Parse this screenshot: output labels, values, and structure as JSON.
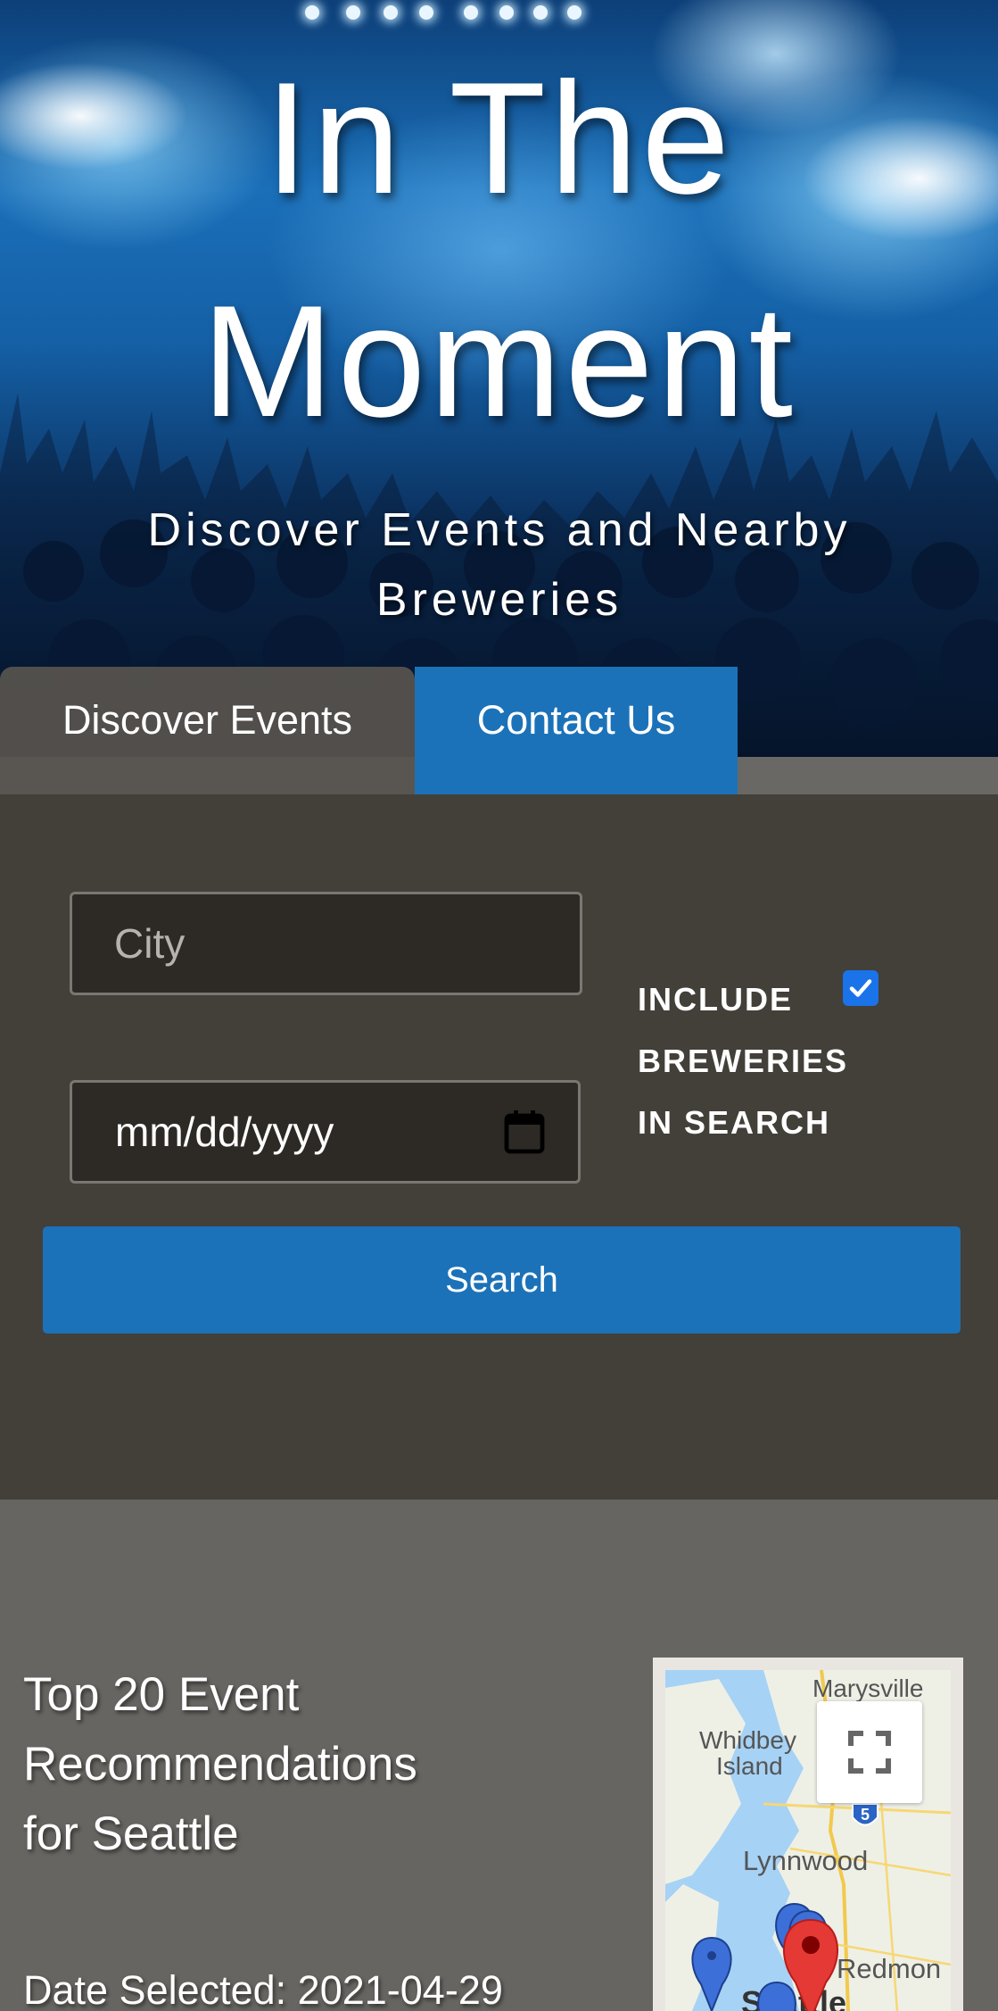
{
  "hero": {
    "title_line1": "In The",
    "title_line2": "Moment",
    "subtitle_line1": "Discover Events and Nearby",
    "subtitle_line2": "Breweries"
  },
  "tabs": [
    {
      "label": "Discover Events",
      "active": false
    },
    {
      "label": "Contact Us",
      "active": true
    }
  ],
  "search": {
    "city_placeholder": "City",
    "date_placeholder": "mm/dd/yyyy",
    "include_label_line1": "INCLUDE",
    "include_label_line2": "BREWERIES",
    "include_label_line3": "IN SEARCH",
    "include_breweries_checked": true,
    "button_label": "Search"
  },
  "results": {
    "title_line1": "Top 20 Event",
    "title_line2": "Recommendations",
    "title_line3": "for Seattle",
    "date_selected": "Date Selected: 2021-04-29"
  },
  "map": {
    "labels": {
      "marysville": "Marysville",
      "whidbey1": "Whidbey",
      "whidbey2": "Island",
      "lynnwood": "Lynnwood",
      "redmond": "Redmon",
      "seattle": "Seattle",
      "highway": "5"
    },
    "fullscreen_icon": "fullscreen-icon"
  },
  "colors": {
    "accent_blue": "#1c72b8",
    "panel_bg": "#433f39",
    "page_bg": "#676561"
  }
}
